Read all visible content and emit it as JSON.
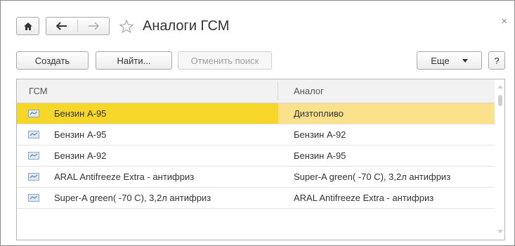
{
  "window": {
    "title": "Аналоги ГСМ"
  },
  "icons": {
    "home": "home-icon",
    "back": "arrow-left-icon",
    "forward": "arrow-right-icon",
    "favorite": "star-icon",
    "close": "close-icon",
    "row": "item-icon",
    "dropdown": "chevron-down-icon"
  },
  "toolbar": {
    "create": "Создать",
    "find": "Найти...",
    "cancel_search": "Отменить поиск",
    "more": "Еще",
    "help": "?"
  },
  "table": {
    "columns": [
      "ГСМ",
      "Аналог"
    ],
    "rows": [
      {
        "fuel": "Бензин А-95",
        "analog": "Дизтопливо"
      },
      {
        "fuel": "Бензин А-95",
        "analog": "Бензин А-92"
      },
      {
        "fuel": "Бензин А-92",
        "analog": "Бензин А-95"
      },
      {
        "fuel": "ARAL Antifreeze Extra - антифриз",
        "analog": "Super-A green( -70 C), 3,2л антифриз"
      },
      {
        "fuel": "Super-A green( -70 C), 3,2л антифриз",
        "analog": "ARAL Antifreeze Extra - антифриз"
      }
    ]
  },
  "colors": {
    "selected_cell": "#f7d62a",
    "selected_row": "#fbe18c"
  }
}
